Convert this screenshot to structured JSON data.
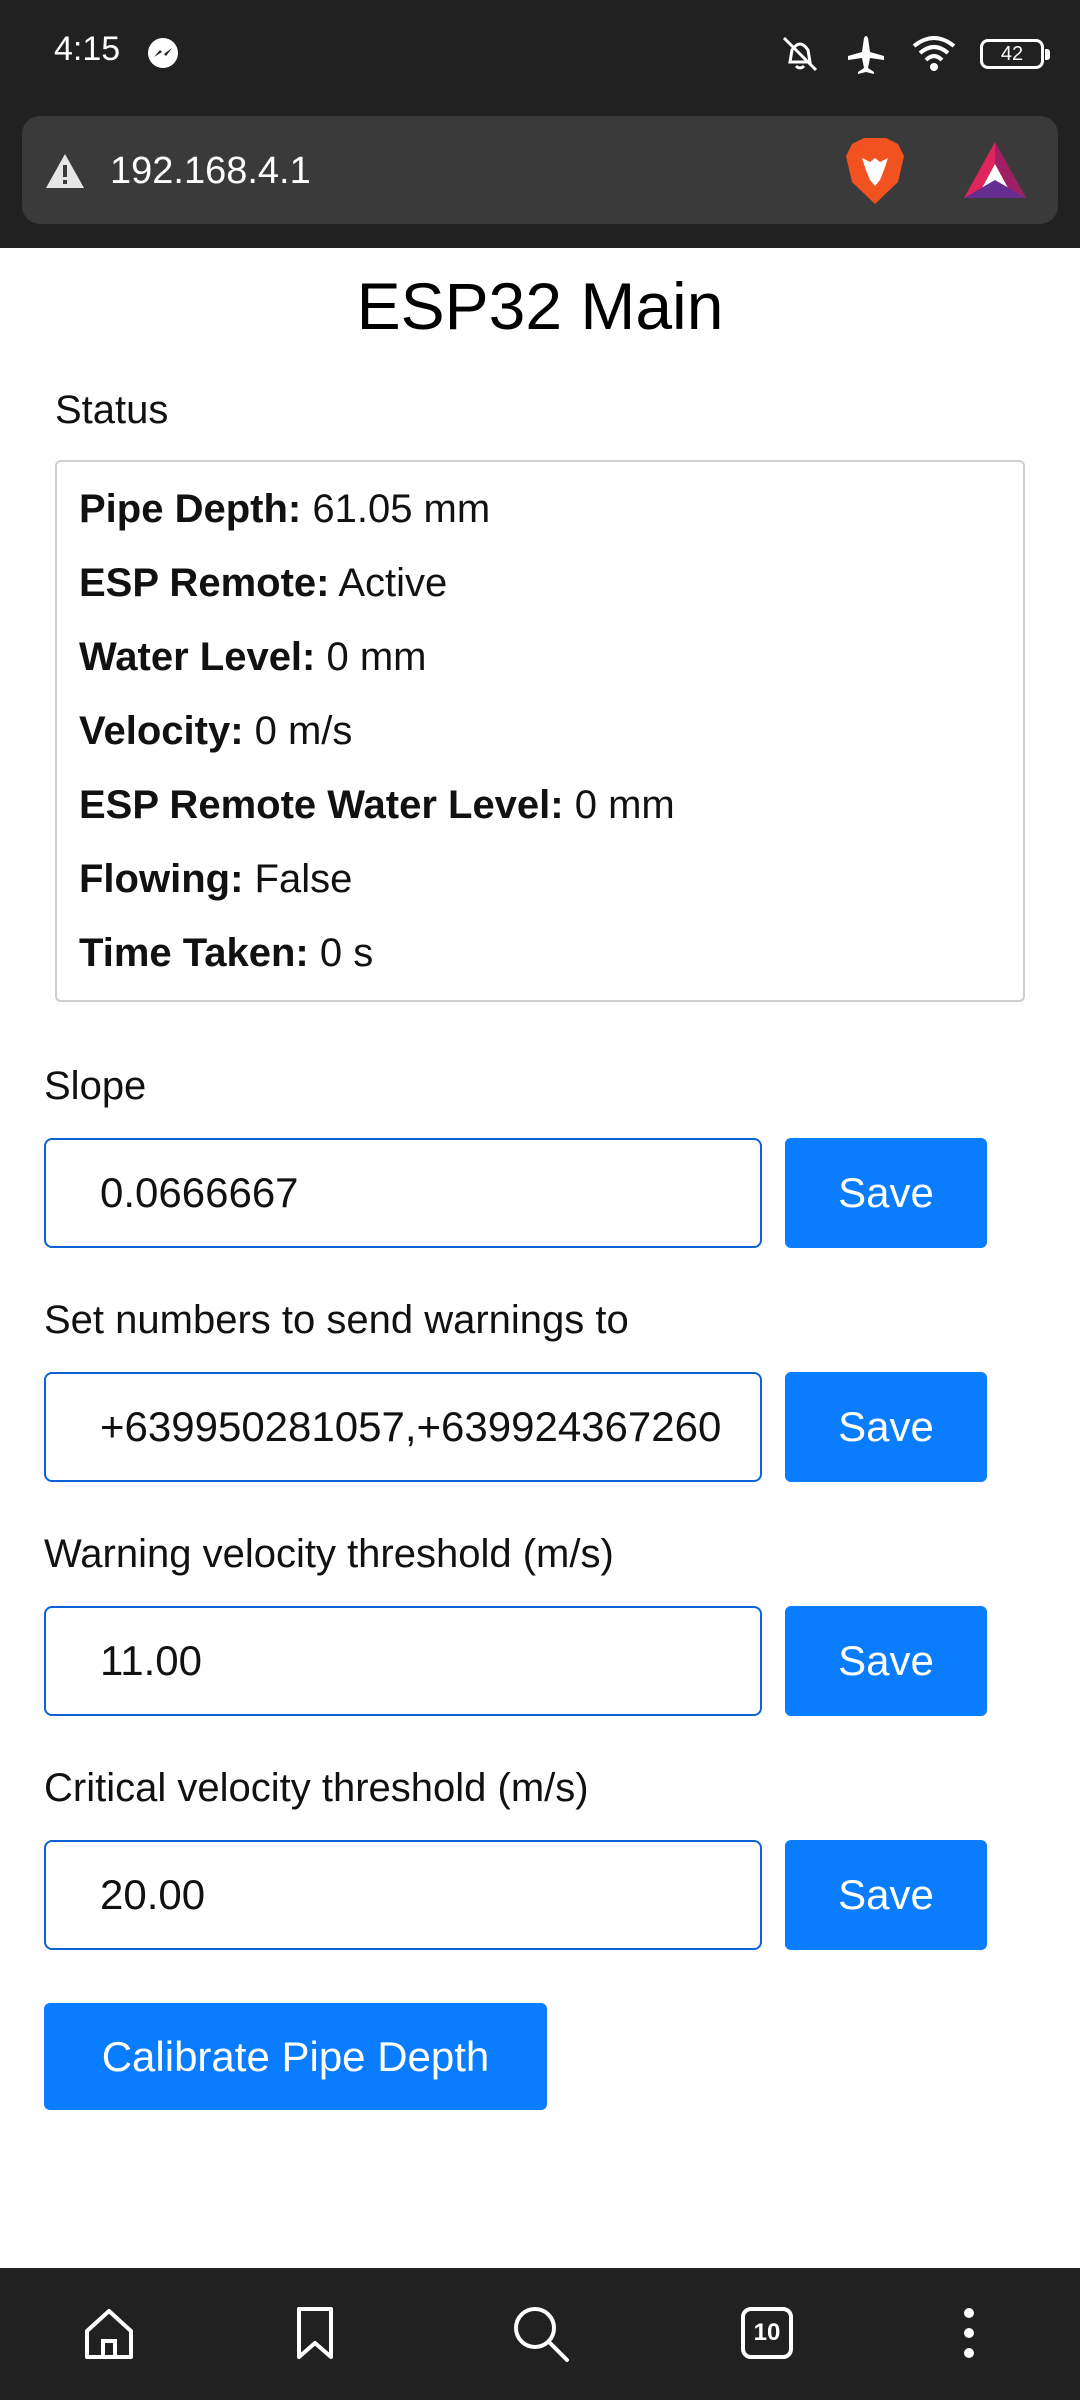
{
  "status_bar": {
    "time": "4:15",
    "battery": "42"
  },
  "browser": {
    "url": "192.168.4.1"
  },
  "page": {
    "title": "ESP32 Main",
    "status_label": "Status",
    "status": [
      {
        "key": "Pipe Depth:",
        "value": " 61.05 mm"
      },
      {
        "key": "ESP Remote:",
        "value": " Active"
      },
      {
        "key": "Water Level:",
        "value": " 0 mm"
      },
      {
        "key": "Velocity:",
        "value": " 0 m/s"
      },
      {
        "key": "ESP Remote Water Level:",
        "value": " 0 mm"
      },
      {
        "key": "Flowing:",
        "value": " False"
      },
      {
        "key": "Time Taken:",
        "value": " 0 s"
      }
    ],
    "fields": [
      {
        "label": "Slope",
        "value": "0.0666667",
        "button": "Save"
      },
      {
        "label": "Set numbers to send warnings to",
        "value": "+639950281057,+639924367260",
        "button": "Save"
      },
      {
        "label": "Warning velocity threshold (m/s)",
        "value": "11.00",
        "button": "Save"
      },
      {
        "label": "Critical velocity threshold (m/s)",
        "value": "20.00",
        "button": "Save"
      }
    ],
    "calibrate_button": "Calibrate Pipe Depth"
  },
  "nav": {
    "tab_count": "10"
  },
  "colors": {
    "accent": "#0a7cff",
    "input_border": "#0b63d6",
    "chrome": "#212121"
  }
}
